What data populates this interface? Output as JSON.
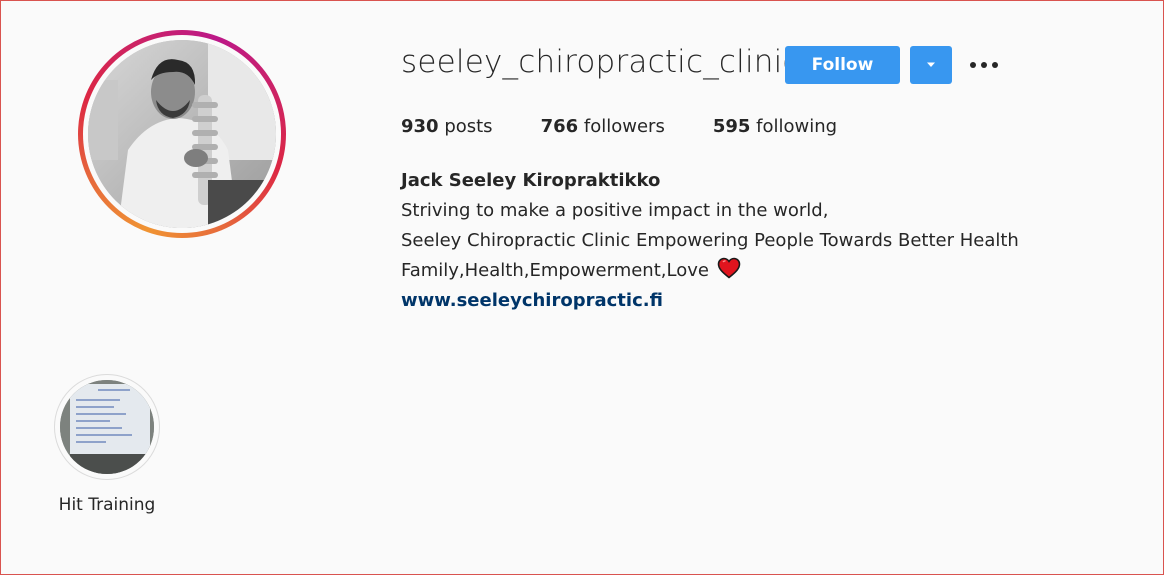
{
  "profile": {
    "username": "seeley_chiropractic_clinic",
    "follow_label": "Follow",
    "dropdown_glyph": "▾",
    "stats": {
      "posts_count": "930",
      "posts_label": "posts",
      "followers_count": "766",
      "followers_label": "followers",
      "following_count": "595",
      "following_label": "following"
    },
    "bio": {
      "full_name": "Jack Seeley Kiropraktikko",
      "line1": "Striving to make a positive impact in the world,",
      "line2": "Seeley Chiropractic Clinic Empowering People Towards Better Health",
      "line3": "Family,Health,Empowerment,Love",
      "link": "www.seeleychiropractic.fi"
    }
  },
  "highlights": [
    {
      "label": "Hit Training"
    }
  ],
  "icons": {
    "more": "more-horizontal-icon",
    "heart": "heart-icon",
    "dropdown": "chevron-down-icon"
  },
  "colors": {
    "accent": "#3897f0",
    "link": "#003569",
    "text": "#262626",
    "background": "#fafafa"
  }
}
